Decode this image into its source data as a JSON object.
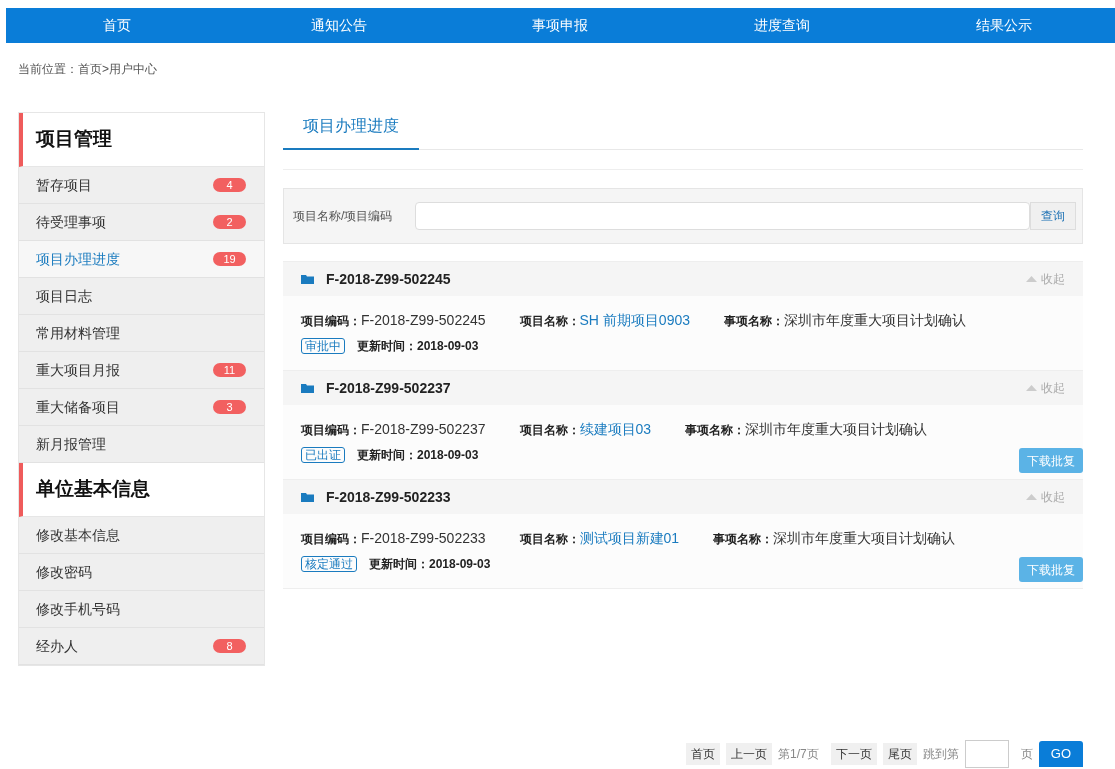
{
  "nav": [
    {
      "label": "首页",
      "selected": false
    },
    {
      "label": "通知公告",
      "selected": false
    },
    {
      "label": "事项申报",
      "selected": false
    },
    {
      "label": "进度查询",
      "selected": false
    },
    {
      "label": "结果公示",
      "selected": false
    }
  ],
  "breadcrumb": "当前位置：首页>用户中心",
  "sidebar": [
    {
      "title": "项目管理",
      "items": [
        {
          "label": "暂存项目",
          "badge": "4",
          "selected": false
        },
        {
          "label": "待受理事项",
          "badge": "2",
          "selected": false
        },
        {
          "label": "项目办理进度",
          "badge": "19",
          "selected": true
        },
        {
          "label": "项目日志",
          "selected": false
        },
        {
          "label": "常用材料管理",
          "selected": false
        },
        {
          "label": "重大项目月报",
          "badge": "11",
          "selected": false
        },
        {
          "label": "重大储备项目",
          "badge": "3",
          "selected": false
        },
        {
          "label": "新月报管理",
          "selected": false
        }
      ]
    },
    {
      "title": "单位基本信息",
      "items": [
        {
          "label": "修改基本信息",
          "selected": false
        },
        {
          "label": "修改密码",
          "selected": false
        },
        {
          "label": "修改手机号码",
          "selected": false
        },
        {
          "label": "经办人",
          "badge": "8",
          "selected": false
        }
      ]
    }
  ],
  "tab": "项目办理进度",
  "search": {
    "label": "项目名称/项目编码",
    "button": "查询"
  },
  "projects": [
    {
      "code": "F-2018-Z99-502245",
      "collapse": "收起",
      "code_label": "项目编码：",
      "code_value": "F-2018-Z99-502245",
      "name_label": "项目名称：",
      "name_value": "SH 前期项目0903",
      "item_label": "事项名称：",
      "item_value": "深圳市年度重大项目计划确认",
      "status": "审批中",
      "time_label": "更新时间：",
      "time_value": "2018-09-03"
    },
    {
      "code": "F-2018-Z99-502237",
      "collapse": "收起",
      "code_label": "项目编码：",
      "code_value": "F-2018-Z99-502237",
      "name_label": "项目名称：",
      "name_value": "续建项目03",
      "item_label": "事项名称：",
      "item_value": "深圳市年度重大项目计划确认",
      "status": "已出证",
      "time_label": "更新时间：",
      "time_value": "2018-09-03",
      "download": "下载批复"
    },
    {
      "code": "F-2018-Z99-502233",
      "collapse": "收起",
      "code_label": "项目编码：",
      "code_value": "F-2018-Z99-502233",
      "name_label": "项目名称：",
      "name_value": "测试项目新建01",
      "item_label": "事项名称：",
      "item_value": "深圳市年度重大项目计划确认",
      "status": "核定通过",
      "time_label": "更新时间：",
      "time_value": "2018-09-03",
      "download": "下载批复"
    }
  ],
  "pagination": {
    "first": "首页",
    "prev": "上一页",
    "page": "第1/7页",
    "next": "下一页",
    "last": "尾页",
    "jump_label": "跳到第",
    "unit": "页",
    "go": "GO"
  }
}
